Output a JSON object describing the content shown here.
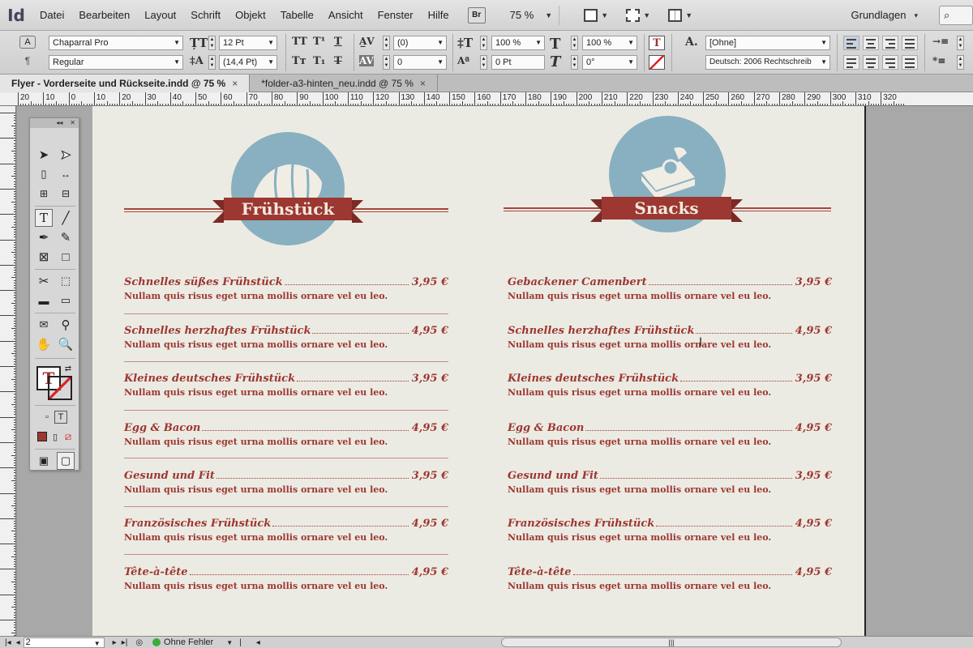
{
  "app": {
    "logo": "Id",
    "menu": [
      "Datei",
      "Bearbeiten",
      "Layout",
      "Schrift",
      "Objekt",
      "Tabelle",
      "Ansicht",
      "Fenster",
      "Hilfe"
    ],
    "bridge_label": "Br",
    "zoom": "75 %",
    "workspace": "Grundlagen"
  },
  "control_panel": {
    "font_family": "Chaparral Pro",
    "font_style": "Regular",
    "font_size": "12 Pt",
    "leading": "(14,4 Pt)",
    "kerning": "(0)",
    "tracking": "0",
    "vertical_scale": "100 %",
    "horizontal_scale": "100 %",
    "baseline_shift": "0 Pt",
    "skew": "0°",
    "char_style": "[Ohne]",
    "language": "Deutsch: 2006 Rechtschreib"
  },
  "tabs": [
    {
      "label": "Flyer - Vorderseite und Rückseite.indd @ 75 %",
      "active": true
    },
    {
      "label": "*folder-a3-hinten_neu.indd @ 75 %",
      "active": false
    }
  ],
  "ruler_labels": [
    "20",
    "10",
    "0",
    "10",
    "20",
    "30",
    "40",
    "50",
    "60",
    "70",
    "80",
    "90",
    "100",
    "110",
    "120",
    "130",
    "140",
    "150",
    "160",
    "170",
    "180",
    "190",
    "200",
    "210",
    "220",
    "230",
    "240",
    "250",
    "260",
    "270",
    "280",
    "290",
    "300",
    "310",
    "320"
  ],
  "menu_columns": [
    {
      "title": "Frühstück",
      "items": [
        {
          "name": "Schnelles süßes Frühstück",
          "price": "3,95 €",
          "desc": "Nullam quis risus eget urna mollis ornare vel eu leo."
        },
        {
          "name": "Schnelles herzhaftes Frühstück",
          "price": "4,95 €",
          "desc": "Nullam quis risus eget urna mollis ornare vel eu leo."
        },
        {
          "name": "Kleines deutsches Frühstück",
          "price": "3,95 €",
          "desc": "Nullam quis risus eget urna mollis ornare vel eu leo."
        },
        {
          "name": "Egg & Bacon",
          "price": "4,95 €",
          "desc": "Nullam quis risus eget urna mollis ornare vel eu leo."
        },
        {
          "name": "Gesund und Fit",
          "price": "3,95 €",
          "desc": "Nullam quis risus eget urna mollis ornare vel eu leo."
        },
        {
          "name": "Französisches Frühstück",
          "price": "4,95 €",
          "desc": "Nullam quis risus eget urna mollis ornare vel eu leo."
        },
        {
          "name": "Tête-à-tête",
          "price": "4,95 €",
          "desc": "Nullam quis risus eget urna mollis ornare vel eu leo."
        }
      ]
    },
    {
      "title": "Snacks",
      "items": [
        {
          "name": "Gebackener Camenbert",
          "price": "3,95 €",
          "desc": "Nullam quis risus eget urna mollis ornare vel eu leo."
        },
        {
          "name": "Schnelles herzhaftes Frühstück",
          "price": "4,95 €",
          "desc": "Nullam quis risus eget urna mollis ornare vel eu leo."
        },
        {
          "name": "Kleines deutsches Frühstück",
          "price": "3,95 €",
          "desc": "Nullam quis risus eget urna mollis ornare vel eu leo."
        },
        {
          "name": "Egg & Bacon",
          "price": "4,95 €",
          "desc": "Nullam quis risus eget urna mollis ornare vel eu leo."
        },
        {
          "name": "Gesund und Fit",
          "price": "3,95 €",
          "desc": "Nullam quis risus eget urna mollis ornare vel eu leo."
        },
        {
          "name": "Französisches Frühstück",
          "price": "4,95 €",
          "desc": "Nullam quis risus eget urna mollis ornare vel eu leo."
        },
        {
          "name": "Tête-à-tête",
          "price": "4,95 €",
          "desc": "Nullam quis risus eget urna mollis ornare vel eu leo."
        }
      ]
    }
  ],
  "status": {
    "page": "2",
    "preflight": "Ohne Fehler"
  },
  "colors": {
    "accent_red": "#9c3731",
    "circle_blue": "#88b0c1",
    "paper": "#ecebe3"
  }
}
